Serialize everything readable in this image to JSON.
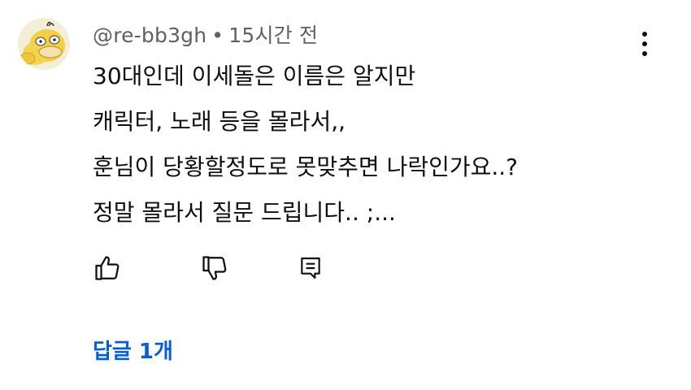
{
  "comment": {
    "author": "@re-bb3gh",
    "separator": "•",
    "time": "15시간 전",
    "avatar_icon": "psyduck-avatar-icon",
    "lines": [
      "30대인데 이세돌은 이름은 알지만",
      "캐릭터, 노래 등을 몰라서,,",
      "훈님이 당황할정도로 못맞추면 나락인가요..?",
      "정말 몰라서 질문 드립니다.. ;..."
    ],
    "more_icon": "more-vertical-icon"
  },
  "actions": {
    "like_icon": "thumbs-up-icon",
    "dislike_icon": "thumbs-down-icon",
    "reply_icon": "reply-comment-icon"
  },
  "replies": {
    "label": "답글 1개"
  },
  "colors": {
    "text": "#0f0f0f",
    "meta": "#606060",
    "link": "#065fd4",
    "avatar_bg": "#f3eed6"
  }
}
